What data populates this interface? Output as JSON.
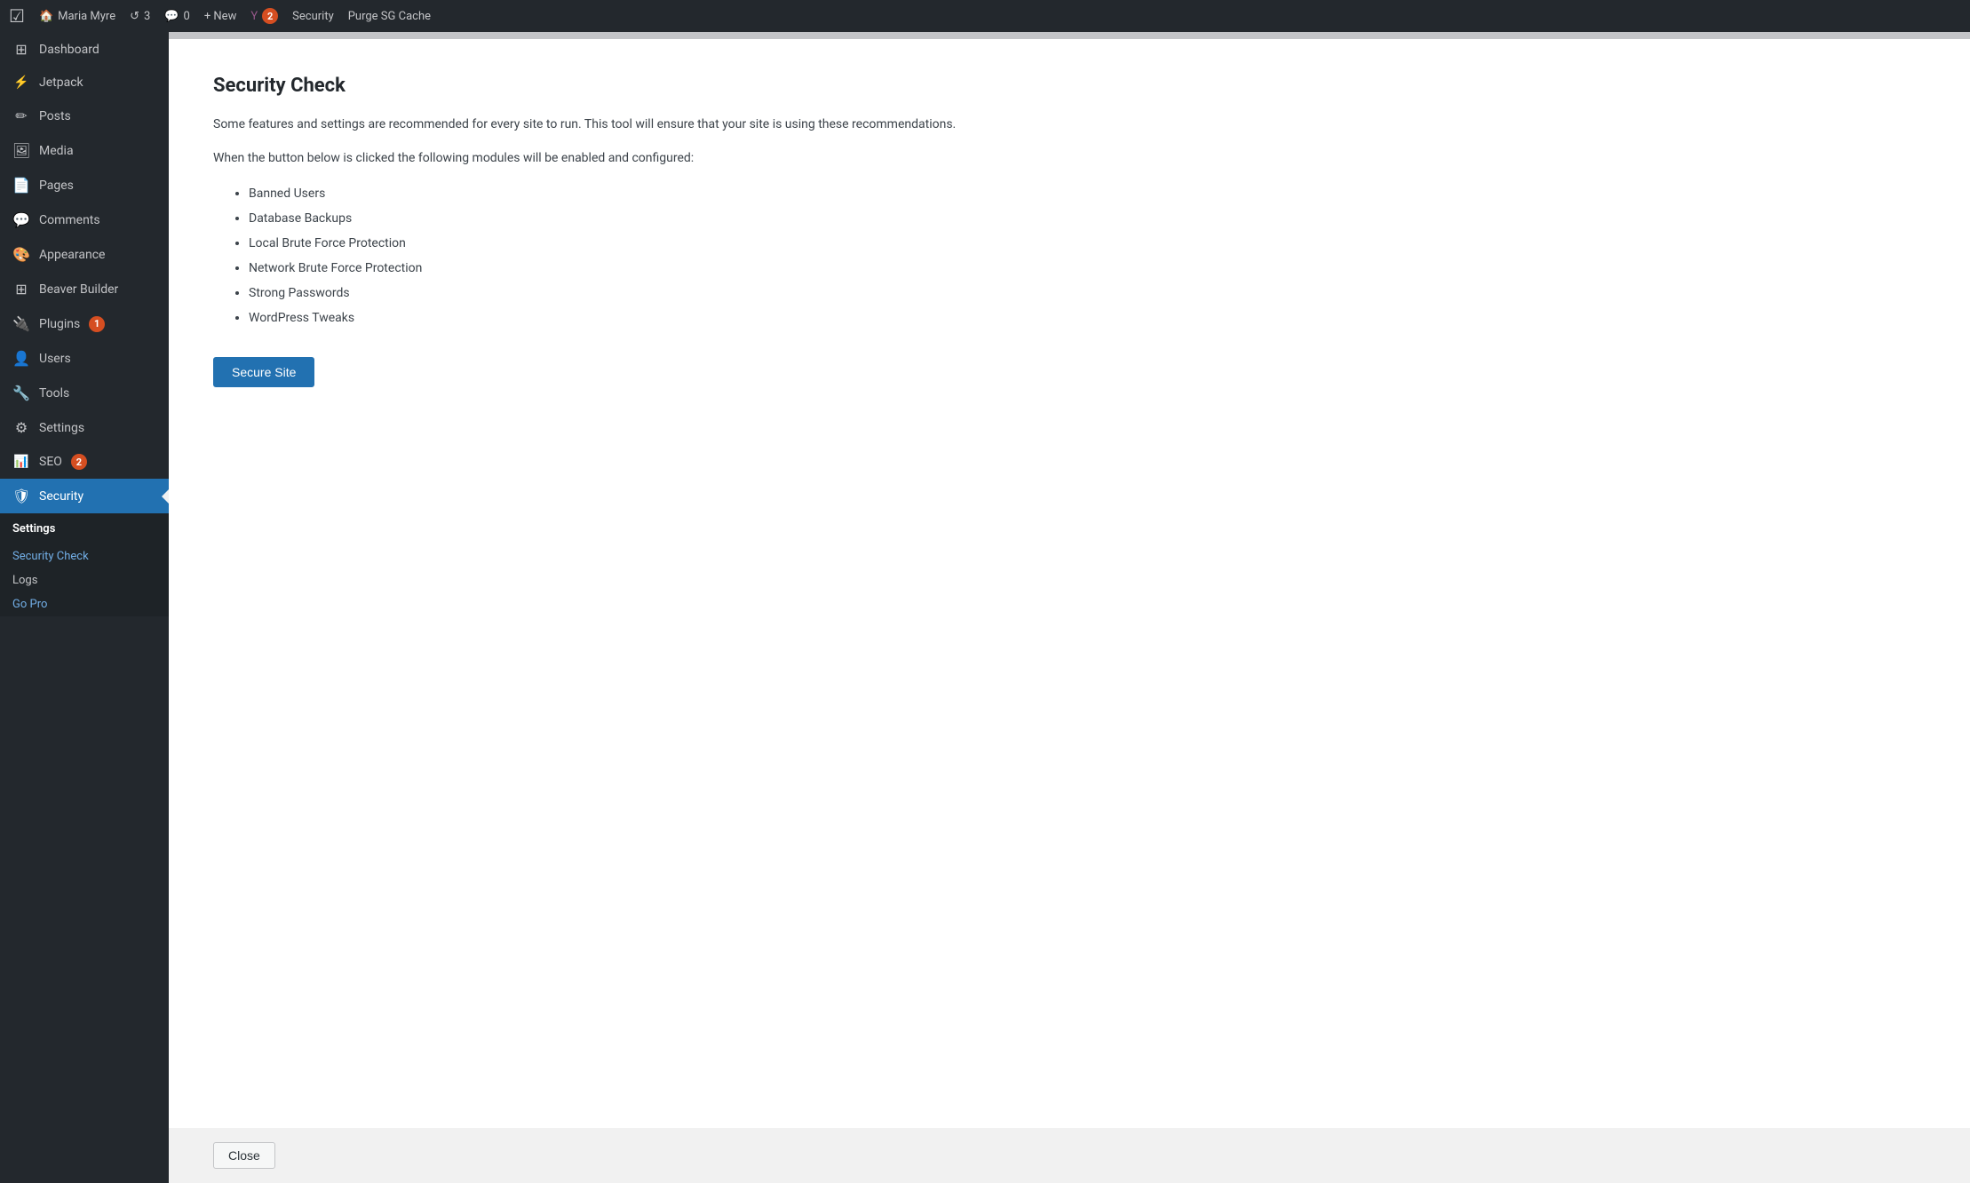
{
  "adminbar": {
    "logo": "W",
    "site_name": "Maria Myre",
    "updates_count": "3",
    "comments_icon": "💬",
    "comments_count": "0",
    "new_label": "+ New",
    "yoast_badge": "2",
    "security_label": "Security",
    "purge_label": "Purge SG Cache"
  },
  "sidebar": {
    "items": [
      {
        "id": "dashboard",
        "label": "Dashboard",
        "icon": "⊞"
      },
      {
        "id": "jetpack",
        "label": "Jetpack",
        "icon": "⚡"
      },
      {
        "id": "posts",
        "label": "Posts",
        "icon": "📌"
      },
      {
        "id": "media",
        "label": "Media",
        "icon": "🖼"
      },
      {
        "id": "pages",
        "label": "Pages",
        "icon": "📄"
      },
      {
        "id": "comments",
        "label": "Comments",
        "icon": "💬"
      },
      {
        "id": "appearance",
        "label": "Appearance",
        "icon": "🎨"
      },
      {
        "id": "beaver-builder",
        "label": "Beaver Builder",
        "icon": "⊞"
      },
      {
        "id": "plugins",
        "label": "Plugins",
        "icon": "🔌",
        "badge": "1"
      },
      {
        "id": "users",
        "label": "Users",
        "icon": "👤"
      },
      {
        "id": "tools",
        "label": "Tools",
        "icon": "🔧"
      },
      {
        "id": "settings",
        "label": "Settings",
        "icon": "⚙"
      },
      {
        "id": "seo",
        "label": "SEO",
        "icon": "📊",
        "badge": "2"
      },
      {
        "id": "security",
        "label": "Security",
        "icon": "🛡",
        "active": true
      }
    ],
    "submenu": {
      "header": "Settings",
      "items": [
        {
          "id": "security-check",
          "label": "Security Check",
          "active": true
        },
        {
          "id": "logs",
          "label": "Logs"
        }
      ],
      "gopro_label": "Go Pro"
    }
  },
  "main": {
    "title": "Security Check",
    "description": "Some features and settings are recommended for every site to run. This tool will ensure that your site is using these recommendations.",
    "modules_intro": "When the button below is clicked the following modules will be enabled and configured:",
    "modules": [
      "Banned Users",
      "Database Backups",
      "Local Brute Force Protection",
      "Network Brute Force Protection",
      "Strong Passwords",
      "WordPress Tweaks"
    ],
    "secure_site_btn": "Secure Site",
    "close_btn": "Close"
  }
}
